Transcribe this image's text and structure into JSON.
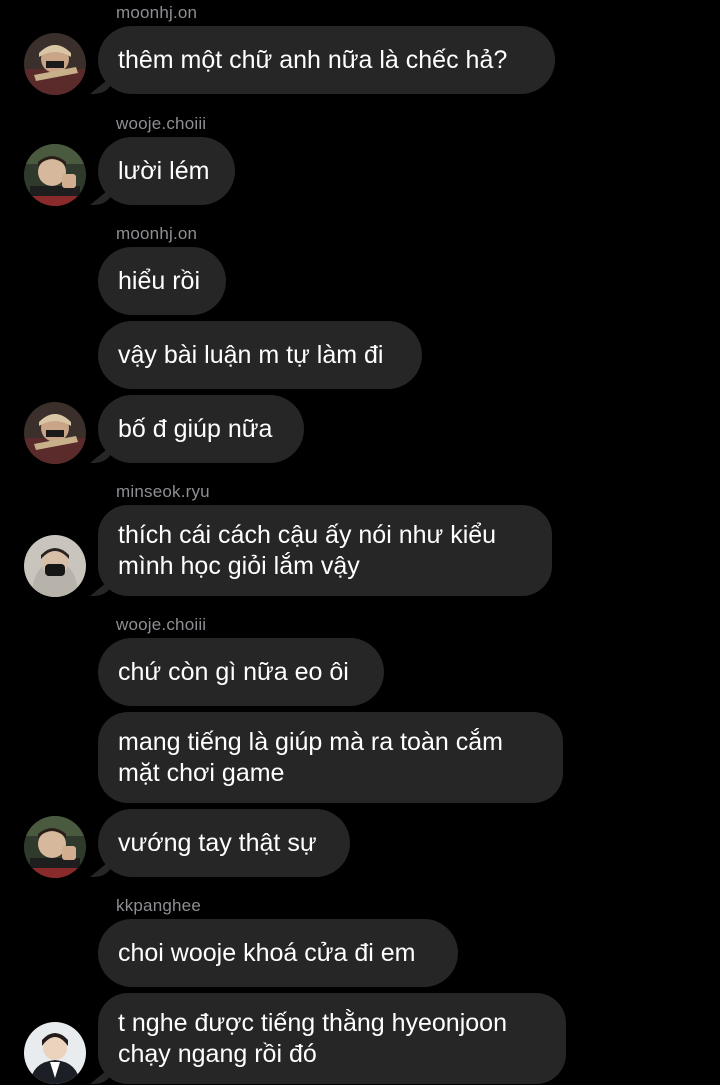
{
  "messages": [
    {
      "sender": "moonhj.on",
      "texts": [
        "thêm một chữ anh nữa là chếc hả?"
      ]
    },
    {
      "sender": "wooje.choiii",
      "texts": [
        "lười lém"
      ]
    },
    {
      "sender": "moonhj.on",
      "texts": [
        "hiểu rồi",
        "vậy bài luận m tự làm đi",
        "bố đ giúp nữa"
      ]
    },
    {
      "sender": "minseok.ryu",
      "texts": [
        "thích cái cách cậu ấy nói như kiểu mình học giỏi lắm vậy"
      ]
    },
    {
      "sender": "wooje.choiii",
      "texts": [
        "chứ còn gì nữa eo ôi",
        "mang tiếng là giúp mà ra toàn cắm mặt chơi game",
        "vướng tay thật sự"
      ]
    },
    {
      "sender": "kkpanghee",
      "texts": [
        "choi wooje khoá cửa đi em",
        "t nghe được tiếng thằng hyeonjoon chạy ngang rồi đó"
      ]
    }
  ],
  "colors": {
    "background": "#000000",
    "bubble": "#262626",
    "sender_text": "#8e8e93",
    "message_text": "#ffffff"
  },
  "avatars": {
    "moonhj_on": "avatar-moonhj-on",
    "wooje_choiii": "avatar-wooje-choiii",
    "minseok_ryu": "avatar-minseok-ryu",
    "kkpanghee": "avatar-kkpanghee"
  }
}
